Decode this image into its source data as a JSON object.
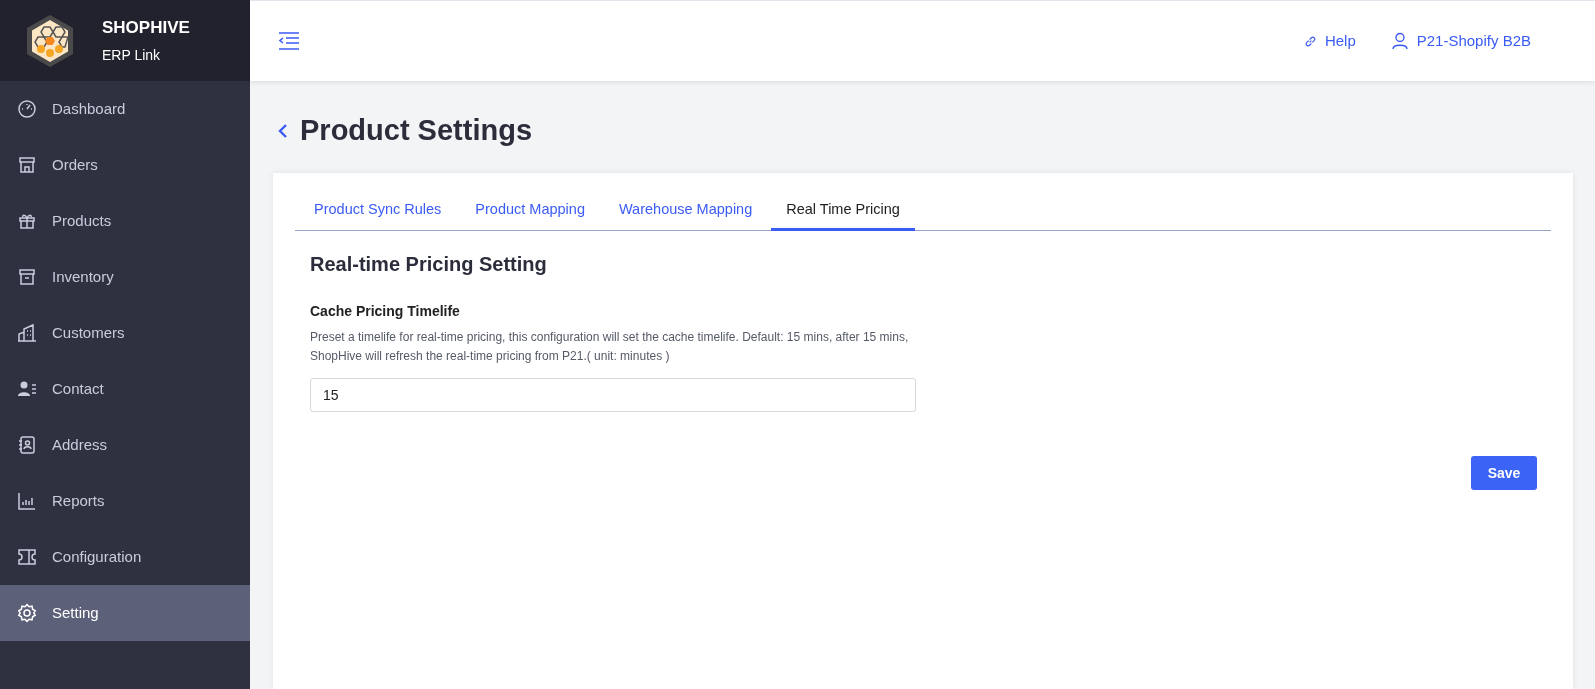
{
  "brand": {
    "name": "SHOPHIVE",
    "subtitle": "ERP Link"
  },
  "sidebar": {
    "items": [
      {
        "label": "Dashboard",
        "selected": false
      },
      {
        "label": "Orders",
        "selected": false
      },
      {
        "label": "Products",
        "selected": false
      },
      {
        "label": "Inventory",
        "selected": false
      },
      {
        "label": "Customers",
        "selected": false
      },
      {
        "label": "Contact",
        "selected": false
      },
      {
        "label": "Address",
        "selected": false
      },
      {
        "label": "Reports",
        "selected": false
      },
      {
        "label": "Configuration",
        "selected": false
      },
      {
        "label": "Setting",
        "selected": true
      }
    ]
  },
  "header": {
    "help": "Help",
    "account": "P21-Shopify B2B"
  },
  "page": {
    "title": "Product Settings"
  },
  "tabs": [
    {
      "label": "Product Sync Rules",
      "selected": false
    },
    {
      "label": "Product Mapping",
      "selected": false
    },
    {
      "label": "Warehouse Mapping",
      "selected": false
    },
    {
      "label": "Real Time Pricing",
      "selected": true
    }
  ],
  "section": {
    "title": "Real-time Pricing Setting",
    "field_label": "Cache Pricing Timelife",
    "description": "Preset a timelife for real-time pricing, this configuration will set the cache timelife. Default: 15 mins, after 15 mins, ShopHive will refresh the real-time pricing from P21.( unit: minutes )",
    "value": "15"
  },
  "save_button": "Save"
}
